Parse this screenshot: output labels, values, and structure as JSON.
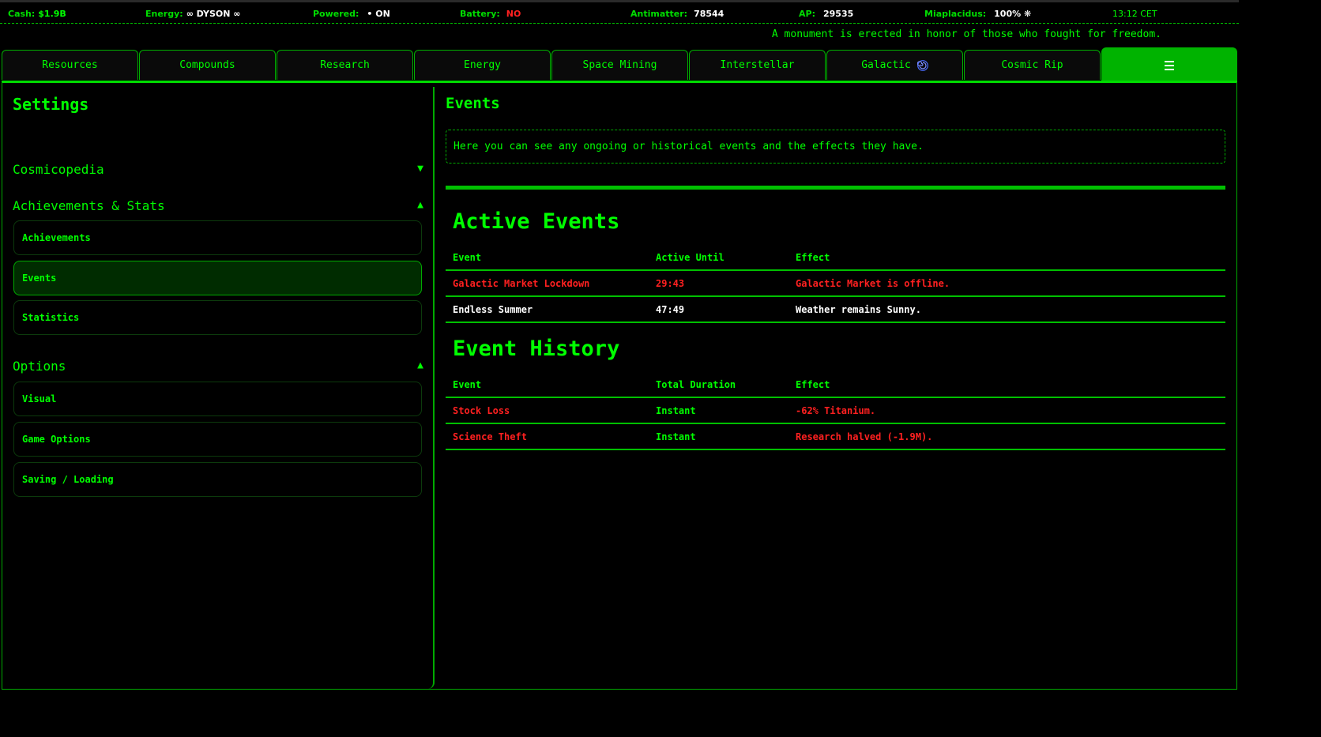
{
  "status_bar": {
    "cash_label": "Cash:",
    "cash_value": "$1.9B",
    "energy_label": "Energy:",
    "energy_value": "∞ DYSON ∞",
    "powered_label": "Powered:",
    "powered_value": "• ON",
    "battery_label": "Battery:",
    "battery_value": "NO",
    "antimatter_label": "Antimatter:",
    "antimatter_value": "78544",
    "ap_label": "AP:",
    "ap_value": "29535",
    "miaplacidus_label": "Miaplacidus:",
    "miaplacidus_value": "100% ❋",
    "clock": "13:12 CET"
  },
  "ticker": "A monument is erected in honor of those who fought for freedom.",
  "tabs": [
    {
      "label": "Resources"
    },
    {
      "label": "Compounds"
    },
    {
      "label": "Research"
    },
    {
      "label": "Energy"
    },
    {
      "label": "Space Mining"
    },
    {
      "label": "Interstellar"
    },
    {
      "label": "Galactic"
    },
    {
      "label": "Cosmic Rip"
    }
  ],
  "sidebar": {
    "title": "Settings",
    "sections": [
      {
        "label": "Cosmicopedia",
        "arrow": "▼"
      },
      {
        "label": "Achievements & Stats",
        "arrow": "▲"
      },
      {
        "label": "Options",
        "arrow": "▲"
      }
    ],
    "achievements_items": [
      {
        "label": "Achievements"
      },
      {
        "label": "Events"
      },
      {
        "label": "Statistics"
      }
    ],
    "options_items": [
      {
        "label": "Visual"
      },
      {
        "label": "Game Options"
      },
      {
        "label": "Saving / Loading"
      }
    ]
  },
  "main": {
    "title": "Events",
    "description": "Here you can see any ongoing or historical events and the effects they have.",
    "active": {
      "heading": "Active Events",
      "columns": [
        "Event",
        "Active Until",
        "Effect"
      ],
      "rows": [
        {
          "event": "Galactic Market Lockdown",
          "time": "29:43",
          "effect": "Galactic Market is offline.",
          "color": "#ff2020"
        },
        {
          "event": "Endless Summer",
          "time": "47:49",
          "effect": "Weather remains Sunny.",
          "color": "#ffffff"
        }
      ]
    },
    "history": {
      "heading": "Event History",
      "columns": [
        "Event",
        "Total Duration",
        "Effect"
      ],
      "rows": [
        {
          "event": "Stock Loss",
          "time": "Instant",
          "effect": "-62% Titanium."
        },
        {
          "event": "Science Theft",
          "time": "Instant",
          "effect": "Research halved (-1.9M)."
        }
      ]
    }
  },
  "colors": {
    "accent": "#00ff00",
    "active_tab": "#00b300",
    "negative": "#ff2020",
    "neutral": "#ffffff"
  },
  "icons": {
    "galactic_tab": "galaxy-spiral-icon",
    "menu_tab": "hamburger-menu-icon"
  }
}
